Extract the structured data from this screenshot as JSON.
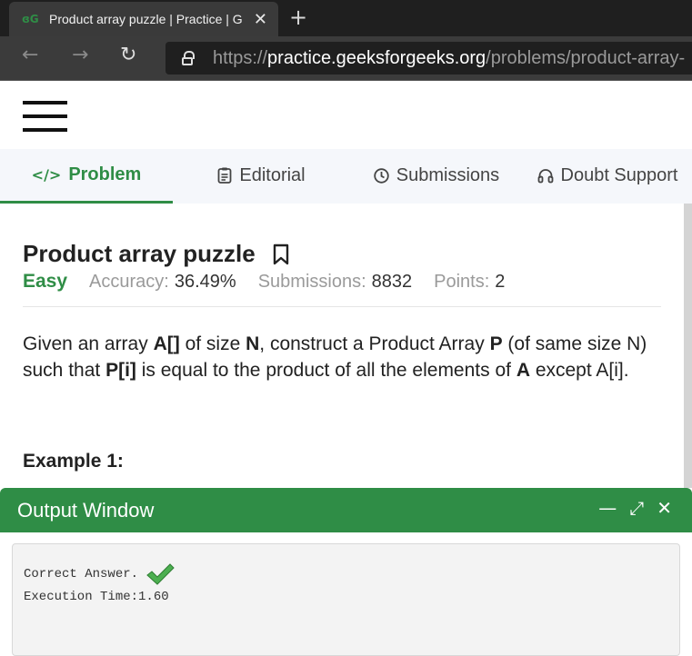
{
  "browser": {
    "tab_title": "Product array puzzle | Practice | G",
    "tab_favicon": "geeksforgeeks-logo-icon",
    "url_scheme": "https://",
    "url_host": "practice.geeksforgeeks.org",
    "url_path": "/problems/product-array-"
  },
  "tabs": [
    {
      "label": "Problem",
      "icon": "code-icon"
    },
    {
      "label": "Editorial",
      "icon": "document-icon"
    },
    {
      "label": "Submissions",
      "icon": "clock-icon"
    },
    {
      "label": "Doubt Support",
      "icon": "headset-icon"
    }
  ],
  "problem": {
    "title": "Product array puzzle",
    "difficulty": "Easy",
    "accuracy_label": "Accuracy:",
    "accuracy_value": "36.49%",
    "submissions_label": "Submissions:",
    "submissions_value": "8832",
    "points_label": "Points:",
    "points_value": "2",
    "desc": {
      "t1": "Given an array ",
      "b1": "A[]",
      "t2": " of size ",
      "b2": "N",
      "t3": ", construct a Product Array ",
      "b3": "P",
      "t4": " (of same size N) such that ",
      "b4": "P[i]",
      "t5": " is equal to the product of all the elements of ",
      "b5": "A",
      "t6": " except A[i]."
    },
    "example_heading": "Example 1:"
  },
  "output": {
    "title": "Output Window",
    "result": "Correct Answer.",
    "execution_time": "Execution Time:1.60"
  },
  "colors": {
    "brand_green": "#2f8d46",
    "check_green": "#4caf50"
  }
}
